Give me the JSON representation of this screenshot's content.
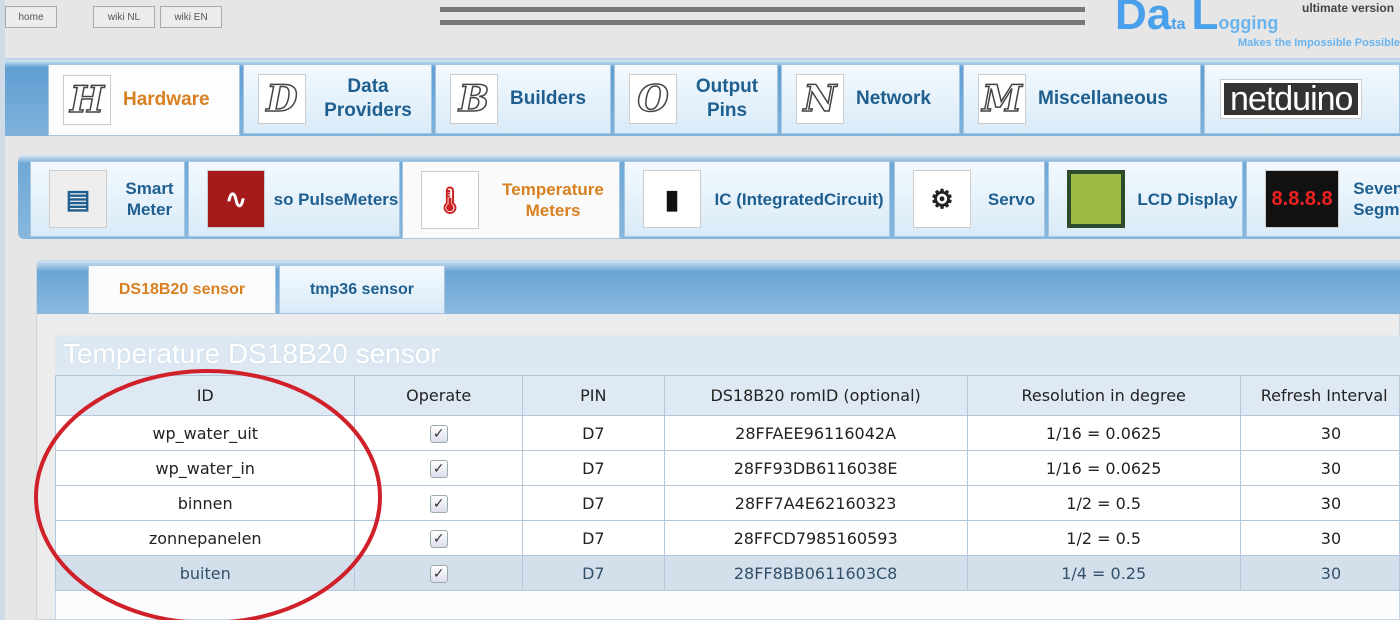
{
  "header": {
    "buttons": [
      "home",
      "wiki NL",
      "wiki EN"
    ],
    "logo_big": "Da",
    "logo_small1": "ta",
    "logo_big2": "L",
    "logo_small2": "ogging",
    "version": "ultimate version",
    "slogan": "Makes the Impossible Possible"
  },
  "main_tabs": [
    {
      "letter": "H",
      "label": "Hardware",
      "active": true
    },
    {
      "letter": "D",
      "label": "Data Providers"
    },
    {
      "letter": "B",
      "label": "Builders"
    },
    {
      "letter": "O",
      "label": "Output Pins"
    },
    {
      "letter": "N",
      "label": "Network"
    },
    {
      "letter": "M",
      "label": "Miscellaneous"
    },
    {
      "label": "netduino"
    }
  ],
  "sub_tabs": [
    {
      "label": "Smart Meter",
      "icon": "smart-meter-icon"
    },
    {
      "label": "so PulseMeters",
      "icon": "pulse-icon"
    },
    {
      "label": "Temperature Meters",
      "icon": "thermometer-icon",
      "active": true
    },
    {
      "label": "IC (IntegratedCircuit)",
      "icon": "chip-icon"
    },
    {
      "label": "Servo",
      "icon": "servo-icon"
    },
    {
      "label": "LCD Display",
      "icon": "lcd-icon"
    },
    {
      "label": "Seven Segment",
      "icon": "seven-segment-icon"
    }
  ],
  "sensor_tabs": [
    {
      "label": "DS18B20 sensor",
      "active": true
    },
    {
      "label": "tmp36 sensor"
    }
  ],
  "table": {
    "title": "Temperature DS18B20 sensor",
    "columns": [
      "ID",
      "Operate",
      "PIN",
      "DS18B20 romID (optional)",
      "Resolution in degree",
      "Refresh Interval"
    ],
    "rows": [
      {
        "id": "wp_water_uit",
        "operate": true,
        "pin": "D7",
        "rom": "28FFAEE96116042A",
        "res": "1/16 = 0.0625",
        "refresh": "30"
      },
      {
        "id": "wp_water_in",
        "operate": true,
        "pin": "D7",
        "rom": "28FF93DB6116038E",
        "res": "1/16 = 0.0625",
        "refresh": "30"
      },
      {
        "id": "binnen",
        "operate": true,
        "pin": "D7",
        "rom": "28FF7A4E62160323",
        "res": "1/2 = 0.5",
        "refresh": "30"
      },
      {
        "id": "zonnepanelen",
        "operate": true,
        "pin": "D7",
        "rom": "28FFCD7985160593",
        "res": "1/2 = 0.5",
        "refresh": "30"
      },
      {
        "id": "buiten",
        "operate": true,
        "pin": "D7",
        "rom": "28FF8BB0611603C8",
        "res": "1/4 = 0.25",
        "refresh": "30",
        "selected": true
      }
    ],
    "checkmark": "✓"
  },
  "colors": {
    "accent": "#d8801f",
    "tab_text": "#1f5f8f",
    "annotation": "#d0202a"
  }
}
